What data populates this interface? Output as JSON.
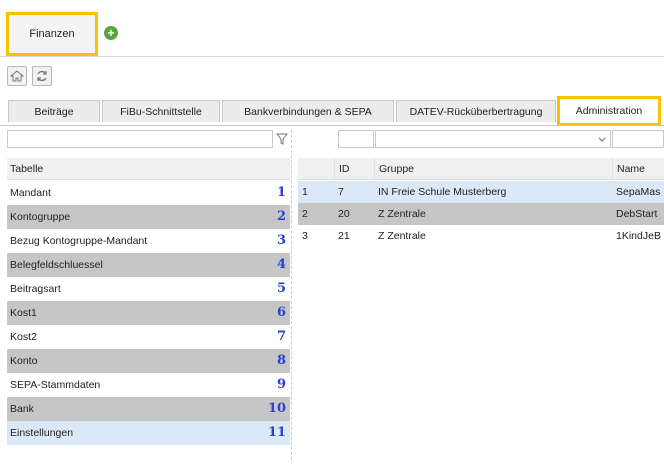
{
  "top_tabs": {
    "active_label": "Finanzen"
  },
  "toolbar": {
    "home_icon": "home-icon",
    "refresh_icon": "refresh-icon"
  },
  "subtabs": [
    {
      "label": "Beiträge"
    },
    {
      "label": "FiBu-Schnittstelle"
    },
    {
      "label": "Bankverbindungen & SEPA"
    },
    {
      "label": "DATEV-Rücküberbertragung"
    },
    {
      "label": "Administration",
      "active": true
    }
  ],
  "left_panel": {
    "filter_value": "",
    "header": "Tabelle",
    "rows": [
      {
        "label": "Mandant",
        "num": "1"
      },
      {
        "label": "Kontogruppe",
        "num": "2"
      },
      {
        "label": "Bezug Kontogruppe-Mandant",
        "num": "3"
      },
      {
        "label": "Belegfeldschluessel",
        "num": "4"
      },
      {
        "label": "Beitragsart",
        "num": "5"
      },
      {
        "label": "Kost1",
        "num": "6"
      },
      {
        "label": "Kost2",
        "num": "7"
      },
      {
        "label": "Konto",
        "num": "8"
      },
      {
        "label": "SEPA-Stammdaten",
        "num": "9"
      },
      {
        "label": "Bank",
        "num": "10"
      },
      {
        "label": "Einstellungen",
        "num": "11"
      }
    ]
  },
  "grid": {
    "columns": [
      "",
      "ID",
      "Gruppe",
      "Name"
    ],
    "rows": [
      {
        "n": "1",
        "id": "7",
        "gruppe": "IN Freie Schule Musterberg",
        "name": "SepaMas"
      },
      {
        "n": "2",
        "id": "20",
        "gruppe": "Z Zentrale",
        "name": "DebStart"
      },
      {
        "n": "3",
        "id": "21",
        "gruppe": "Z Zentrale",
        "name": "1KindJeB"
      }
    ]
  },
  "colors": {
    "highlight": "#f5c400",
    "row_grey": "#c6c6c6",
    "row_selected": "#dbe8f8",
    "number_blue": "#2d3fd3",
    "add_green": "#5aa63a"
  }
}
